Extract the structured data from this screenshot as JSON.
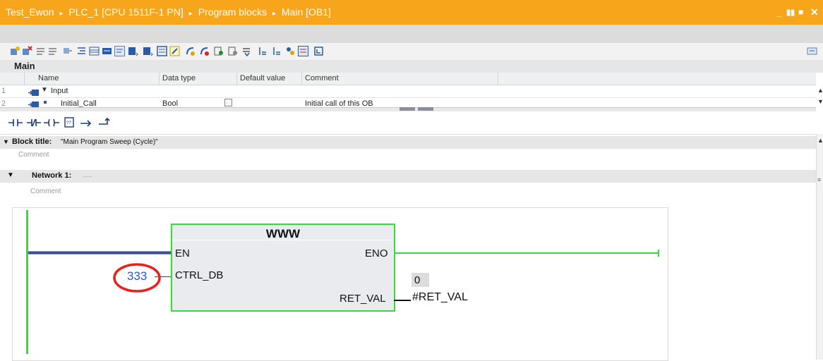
{
  "titlebar": {
    "crumbs": [
      "Test_Ewon",
      "PLC_1 [CPU 1511F-1 PN]",
      "Program blocks",
      "Main [OB1]"
    ],
    "separator": "▸",
    "window_controls": [
      "_",
      "▮▮",
      "■",
      "✕"
    ]
  },
  "interface": {
    "title": "Main",
    "columns": [
      "Name",
      "Data type",
      "Default value",
      "Comment"
    ],
    "rows": [
      {
        "num": "1",
        "name": "Input",
        "type": "",
        "default": "",
        "comment": "",
        "expanded": true
      },
      {
        "num": "2",
        "name": "Initial_Call",
        "type": "Bool",
        "default": "",
        "comment": "Initial call of this OB"
      }
    ]
  },
  "ladder_palette": [
    "normally-open-contact",
    "normally-closed-contact",
    "output-coil",
    "empty-box",
    "open-branch",
    "close-branch"
  ],
  "block_title": {
    "label": "Block title:",
    "value": "\"Main Program Sweep (Cycle)\"",
    "comment": "Comment"
  },
  "network": {
    "label": "Network 1:",
    "title_placeholder": ".....",
    "comment": "Comment"
  },
  "function_block": {
    "name": "WWW",
    "en": "EN",
    "eno": "ENO",
    "ctrl_db": "CTRL_DB",
    "ctrl_db_value": "333",
    "ret_val": "RET_VAL",
    "ret_val_monitor": "0",
    "ret_val_operand": "#RET_VAL"
  },
  "colors": {
    "titlebar": "#f7a51b",
    "power_green": "#33dd33",
    "highlight_red": "#e8201f",
    "wire_blue": "#3b4d8c"
  }
}
